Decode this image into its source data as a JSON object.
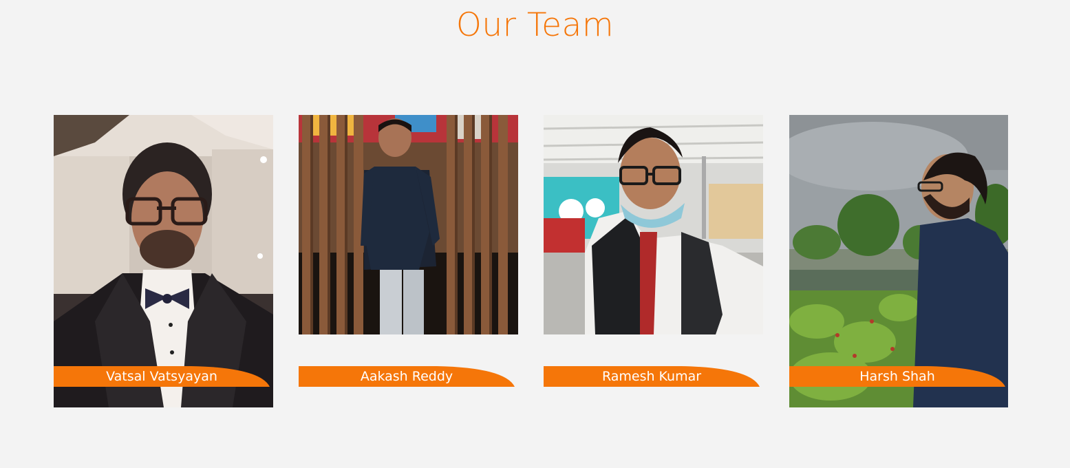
{
  "section": {
    "title": "Our Team",
    "accent_color": "#f57609",
    "background_color": "#f3f3f3"
  },
  "team": [
    {
      "name": "Vatsal Vatsyayan",
      "photo_icon": "portrait-photo-suit-bowtie"
    },
    {
      "name": "Aakash Reddy",
      "photo_icon": "portrait-photo-wooden-slats"
    },
    {
      "name": "Ramesh Kumar",
      "photo_icon": "portrait-photo-airport-selfie"
    },
    {
      "name": "Harsh Shah",
      "photo_icon": "portrait-photo-outdoor-trees"
    }
  ]
}
